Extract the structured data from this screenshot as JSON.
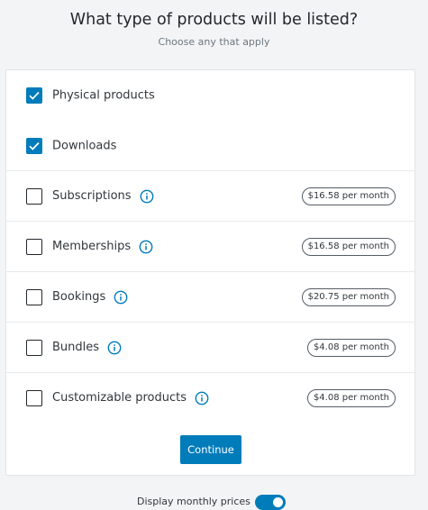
{
  "header": {
    "title": "What type of products will be listed?",
    "subtitle": "Choose any that apply"
  },
  "product_types": [
    {
      "label": "Physical products",
      "checked": true,
      "info_icon": false,
      "price": ""
    },
    {
      "label": "Downloads",
      "checked": true,
      "info_icon": false,
      "price": ""
    },
    {
      "label": "Subscriptions",
      "checked": false,
      "info_icon": true,
      "price": "$16.58 per month"
    },
    {
      "label": "Memberships",
      "checked": false,
      "info_icon": true,
      "price": "$16.58 per month"
    },
    {
      "label": "Bookings",
      "checked": false,
      "info_icon": true,
      "price": "$20.75 per month"
    },
    {
      "label": "Bundles",
      "checked": false,
      "info_icon": true,
      "price": "$4.08 per month"
    },
    {
      "label": "Customizable products",
      "checked": false,
      "info_icon": true,
      "price": "$4.08 per month"
    }
  ],
  "actions": {
    "continue_label": "Continue"
  },
  "footer": {
    "toggle_label": "Display monthly prices",
    "toggle_on": true
  },
  "colors": {
    "accent": "#007cba",
    "background": "#f3f4f5",
    "card": "#ffffff"
  }
}
